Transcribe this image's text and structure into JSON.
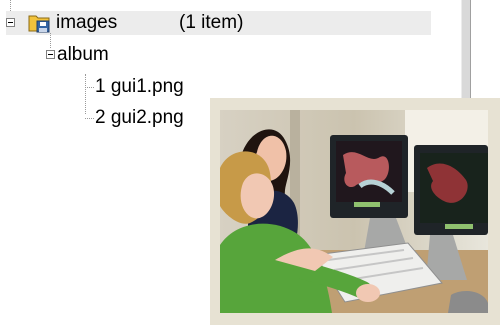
{
  "tree": {
    "root": {
      "label": "images",
      "count": "(1 item)",
      "icon": "folder-save-icon"
    },
    "child": {
      "label": "album"
    },
    "files": [
      {
        "label": "1 gui1.png"
      },
      {
        "label": "2 gui2.png"
      }
    ]
  },
  "photo": {
    "icon": "photo-thumbnail",
    "colors": {
      "frame": "#e7e2d3",
      "screen": "#1f2428",
      "shirt": "#57a53b"
    }
  }
}
